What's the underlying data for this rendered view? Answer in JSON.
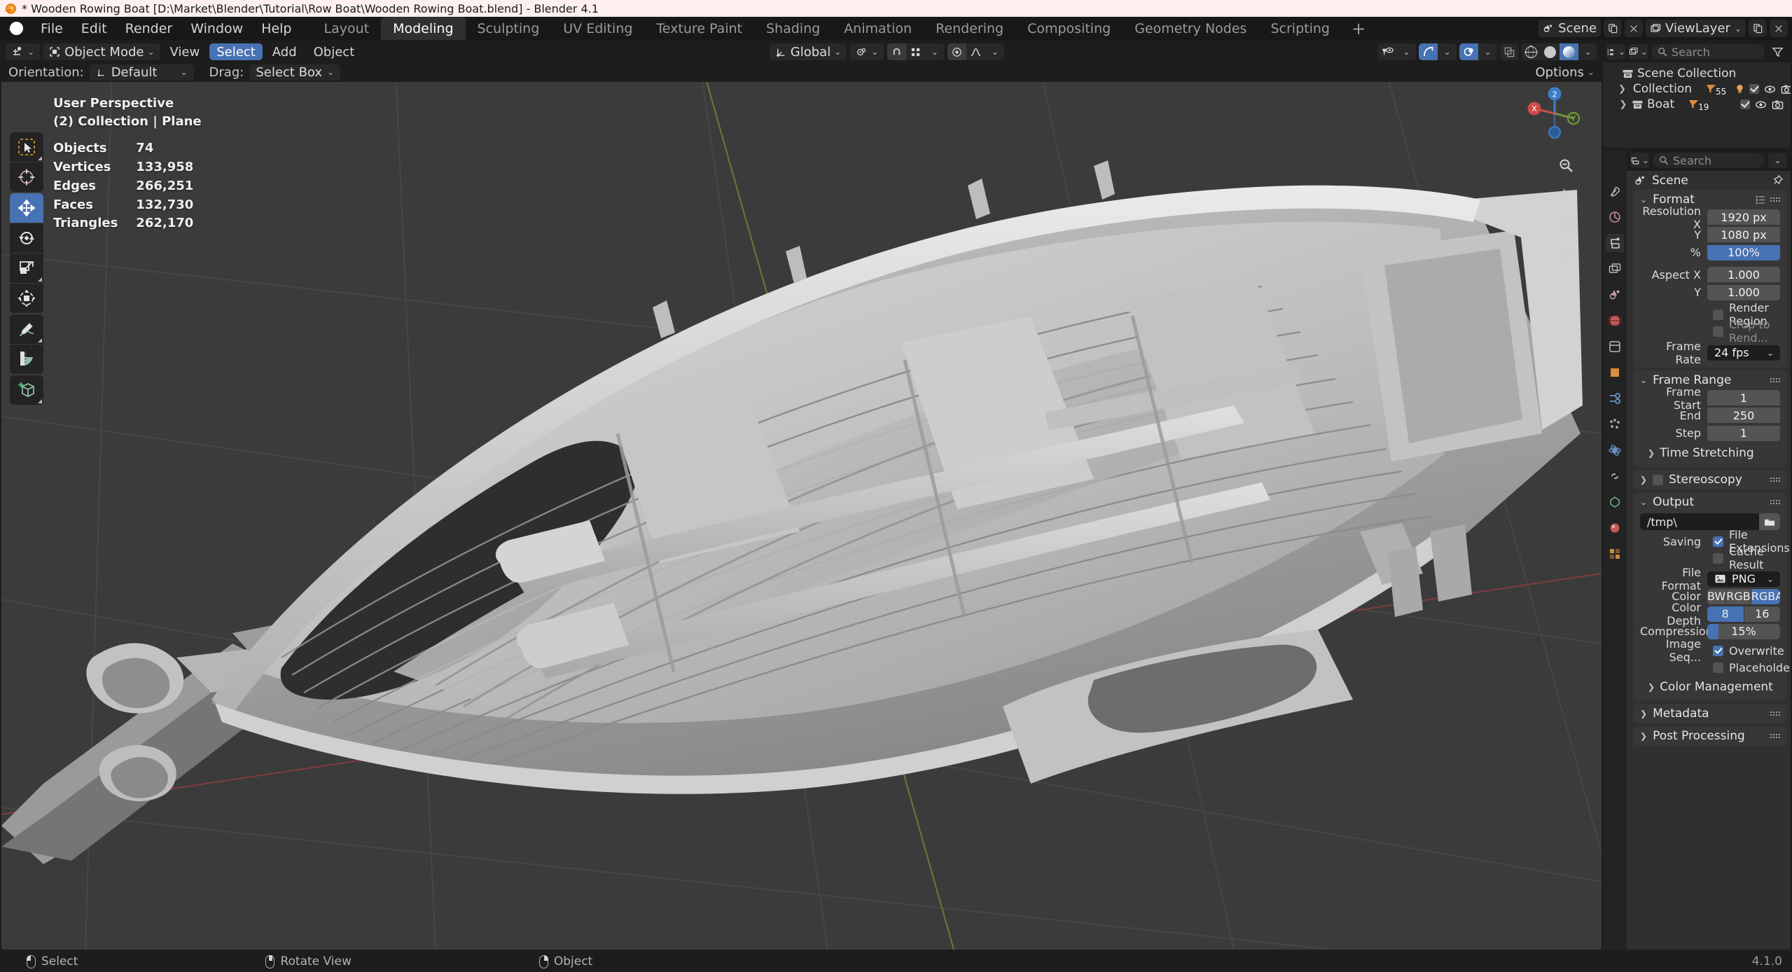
{
  "window": {
    "title": "* Wooden Rowing Boat [D:\\Market\\Blender\\Tutorial\\Row Boat\\Wooden Rowing Boat.blend] - Blender 4.1",
    "logo_icon": "blender-logo-icon"
  },
  "menubar": {
    "items": [
      "File",
      "Edit",
      "Render",
      "Window",
      "Help"
    ],
    "workspace_tabs": [
      {
        "label": "Layout",
        "active": false
      },
      {
        "label": "Modeling",
        "active": true
      },
      {
        "label": "Sculpting",
        "active": false
      },
      {
        "label": "UV Editing",
        "active": false
      },
      {
        "label": "Texture Paint",
        "active": false
      },
      {
        "label": "Shading",
        "active": false
      },
      {
        "label": "Animation",
        "active": false
      },
      {
        "label": "Rendering",
        "active": false
      },
      {
        "label": "Compositing",
        "active": false
      },
      {
        "label": "Geometry Nodes",
        "active": false
      },
      {
        "label": "Scripting",
        "active": false
      }
    ],
    "add_workspace_label": "+",
    "scene_name": "Scene",
    "viewlayer_name": "ViewLayer"
  },
  "viewport_header": {
    "editor_type_icon": "editor-type-icon",
    "mode": "Object Mode",
    "menus": [
      {
        "label": "View",
        "selected": false
      },
      {
        "label": "Select",
        "selected": true
      },
      {
        "label": "Add",
        "selected": false
      },
      {
        "label": "Object",
        "selected": false
      }
    ],
    "transform_orientation": "Global",
    "pivot_icon": "pivot-point-icon",
    "snap_icon": "snap-magnet-icon",
    "snap_to_icon": "snap-to-grid-icon",
    "proportional_icon": "proportional-edit-icon",
    "falloff_icon": "falloff-curve-icon",
    "visibility_icon": "object-visibility-icon",
    "gizmo_icon": "gizmo-icon",
    "overlays_icon": "overlays-icon",
    "xray_icon": "toggle-xray-icon",
    "shading_modes": [
      {
        "name": "wireframe",
        "active": false
      },
      {
        "name": "solid",
        "active": false
      },
      {
        "name": "material-preview",
        "active": true
      },
      {
        "name": "rendered",
        "active": false
      }
    ]
  },
  "tool_settings": {
    "orientation_label": "Orientation:",
    "orientation_value": "Default",
    "drag_label": "Drag:",
    "drag_value": "Select Box",
    "options_label": "Options"
  },
  "viewport_stats": {
    "perspective": "User Perspective",
    "collection_line": "(2) Collection | Plane",
    "rows": [
      {
        "key": "Objects",
        "value": "74"
      },
      {
        "key": "Vertices",
        "value": "133,958"
      },
      {
        "key": "Edges",
        "value": "266,251"
      },
      {
        "key": "Faces",
        "value": "132,730"
      },
      {
        "key": "Triangles",
        "value": "262,170"
      }
    ]
  },
  "toolbar": {
    "tools": [
      {
        "name": "tweak-select-tool",
        "active": false
      },
      {
        "name": "cursor-tool",
        "active": false
      },
      {
        "name": "move-tool",
        "active": true
      },
      {
        "name": "rotate-tool",
        "active": false
      },
      {
        "name": "scale-tool",
        "active": false
      },
      {
        "name": "transform-tool",
        "active": false
      },
      {
        "name": "annotate-tool",
        "active": false
      },
      {
        "name": "measure-tool",
        "active": false
      },
      {
        "name": "add-cube-tool",
        "active": false
      }
    ]
  },
  "nav_gizmo": {
    "axes": [
      {
        "label": "X",
        "color": "#cf4a4a"
      },
      {
        "label": "Y",
        "color": "#8fbf3e"
      },
      {
        "label": "Z",
        "color": "#3c7ec4"
      },
      {
        "label": "2",
        "color": "#3c7ec4"
      }
    ],
    "buttons": [
      {
        "name": "zoom-icon"
      },
      {
        "name": "move-view-icon"
      },
      {
        "name": "camera-view-icon"
      },
      {
        "name": "toggle-perspective-icon"
      }
    ]
  },
  "outliner": {
    "display_mode_icon": "outliner-display-mode-icon",
    "filter_icon": "filter-icon",
    "search_placeholder": "Search",
    "root": "Scene Collection",
    "items": [
      {
        "name": "Collection",
        "icon": "collection-icon",
        "expand_icon": "chevron-right-icon",
        "badges": [
          {
            "name": "mesh-data-badge",
            "count": "55"
          },
          {
            "name": "light-data-badge",
            "count": ""
          }
        ],
        "checkbox": true,
        "eye_icon": "eye-icon",
        "camera_icon": "camera-icon"
      },
      {
        "name": "Boat",
        "icon": "collection-icon",
        "expand_icon": "chevron-right-icon",
        "badges": [
          {
            "name": "mesh-data-badge",
            "count": "19"
          }
        ],
        "checkbox": true,
        "eye_icon": "eye-icon",
        "camera_icon": "camera-icon"
      }
    ]
  },
  "properties": {
    "search_placeholder": "Search",
    "breadcrumb": "Scene",
    "pin_icon": "pin-icon",
    "tabs": [
      {
        "name": "tool-tab",
        "active": false
      },
      {
        "name": "render-tab",
        "active": false
      },
      {
        "name": "output-tab",
        "active": true
      },
      {
        "name": "view-layer-tab",
        "active": false
      },
      {
        "name": "scene-tab",
        "active": false
      },
      {
        "name": "world-tab",
        "active": false
      },
      {
        "name": "collection-tab",
        "active": false
      },
      {
        "name": "object-tab",
        "active": false
      },
      {
        "name": "modifiers-tab",
        "active": false
      },
      {
        "name": "particles-tab",
        "active": false
      },
      {
        "name": "physics-tab",
        "active": false
      },
      {
        "name": "constraints-tab",
        "active": false
      },
      {
        "name": "object-data-tab",
        "active": false
      },
      {
        "name": "material-tab",
        "active": false
      },
      {
        "name": "texture-tab",
        "active": false
      }
    ],
    "format": {
      "title": "Format",
      "resolution_x_label": "Resolution X",
      "resolution_x_value": "1920 px",
      "resolution_y_label": "Y",
      "resolution_y_value": "1080 px",
      "percent_label": "%",
      "percent_value": "100%",
      "aspect_x_label": "Aspect X",
      "aspect_x_value": "1.000",
      "aspect_y_label": "Y",
      "aspect_y_value": "1.000",
      "render_region_label": "Render Region",
      "render_region_checked": false,
      "crop_label": "Crop to Rend...",
      "crop_checked": false,
      "frame_rate_label": "Frame Rate",
      "frame_rate_value": "24 fps"
    },
    "frame_range": {
      "title": "Frame Range",
      "frame_start_label": "Frame Start",
      "frame_start_value": "1",
      "end_label": "End",
      "end_value": "250",
      "step_label": "Step",
      "step_value": "1",
      "time_stretching_label": "Time Stretching"
    },
    "stereoscopy": {
      "title": "Stereoscopy",
      "checked": false
    },
    "output": {
      "title": "Output",
      "path_value": "/tmp\\",
      "folder_icon": "folder-icon",
      "saving_label": "Saving",
      "file_extensions_label": "File Extensions",
      "file_extensions_checked": true,
      "cache_result_label": "Cache Result",
      "cache_result_checked": false,
      "file_format_label": "File Format",
      "file_format_value": "PNG",
      "file_format_icon": "image-file-icon",
      "color_label": "Color",
      "color_options": [
        {
          "label": "BW",
          "active": false
        },
        {
          "label": "RGB",
          "active": false
        },
        {
          "label": "RGBA",
          "active": true
        }
      ],
      "color_depth_label": "Color Depth",
      "color_depth_options": [
        {
          "label": "8",
          "active": true
        },
        {
          "label": "16",
          "active": false
        }
      ],
      "compression_label": "Compression",
      "compression_value": "15%",
      "compression_percent": 15,
      "image_seq_label": "Image Seq...",
      "overwrite_label": "Overwrite",
      "overwrite_checked": true,
      "placeholders_label": "Placeholders",
      "placeholders_checked": false,
      "color_management_label": "Color Management"
    },
    "metadata": {
      "title": "Metadata"
    },
    "post_processing": {
      "title": "Post Processing"
    }
  },
  "statusbar": {
    "items": [
      {
        "mouse": "left",
        "label": "Select"
      },
      {
        "mouse": "middle",
        "label": "Rotate View"
      },
      {
        "mouse": "right",
        "label": "Object"
      }
    ],
    "version": "4.1.0"
  },
  "colors": {
    "accent_blue": "#4772b3",
    "title_bar": "#fdf0ef",
    "panel_bg": "#303030",
    "editor_bg": "#1d1d1d",
    "viewport_bg": "#3b3b3b"
  }
}
